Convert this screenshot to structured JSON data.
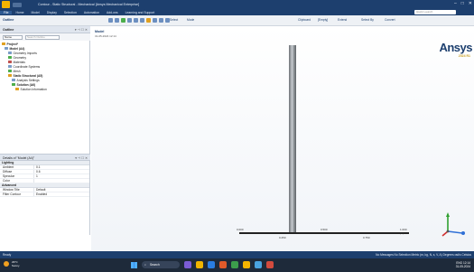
{
  "window": {
    "title": "Contour - Static Structural - Mechanical [Ansys Mechanical Enterprise]",
    "controls": [
      "–",
      "□",
      "✕"
    ]
  },
  "menubar": {
    "tabs": [
      "File",
      "Home",
      "Model",
      "Display",
      "Selection",
      "Automation",
      "Add-ons",
      "Learning and Support"
    ],
    "active_index": 0,
    "search_placeholder": "Quick Launch"
  },
  "toolbar": {
    "outline_label": "Outline",
    "select_label": "Select",
    "mode_label": "Mode",
    "clipboard_label": "Clipboard",
    "empty_label": "[Empty]",
    "extend_label": "Extend",
    "select_by_label": "Select By",
    "convert_label": "Convert"
  },
  "outline": {
    "header": "Outline",
    "pin": "▾ ⊣ ☐ ✕",
    "filter_label": "Name",
    "search_placeholder": "Search Outline",
    "tree": [
      {
        "label": "Project*",
        "level": 0,
        "icon": "project-icon",
        "bold": true
      },
      {
        "label": "Model (A4)",
        "level": 1,
        "icon": "model-icon",
        "bold": true
      },
      {
        "label": "Geometry Imports",
        "level": 2,
        "icon": "geometry-imports-icon"
      },
      {
        "label": "Geometry",
        "level": 2,
        "icon": "geometry-icon"
      },
      {
        "label": "Materials",
        "level": 2,
        "icon": "materials-icon"
      },
      {
        "label": "Coordinate Systems",
        "level": 2,
        "icon": "coordinate-systems-icon"
      },
      {
        "label": "Mesh",
        "level": 2,
        "icon": "mesh-icon"
      },
      {
        "label": "Static Structural (A5)",
        "level": 2,
        "icon": "static-structural-icon",
        "bold": true
      },
      {
        "label": "Analysis Settings",
        "level": 3,
        "icon": "analysis-settings-icon"
      },
      {
        "label": "Solution (A6)",
        "level": 3,
        "icon": "solution-icon",
        "bold": true
      },
      {
        "label": "Solution Information",
        "level": 4,
        "icon": "solution-information-icon"
      }
    ]
  },
  "details": {
    "header": "Details of \"Model (A4)\"",
    "pin": "▾ ⊣ ☐ ✕",
    "sections": [
      {
        "title": "Lighting",
        "rows": [
          {
            "key": "Ambient",
            "value": "0.1"
          },
          {
            "key": "Diffuse",
            "value": "0.6"
          },
          {
            "key": "Specular",
            "value": "1"
          },
          {
            "key": "Color",
            "value": ""
          }
        ]
      },
      {
        "title": "Advanced",
        "rows": [
          {
            "key": "Window Title",
            "value": "Default"
          },
          {
            "key": "Filter Contour",
            "value": "Enabled"
          }
        ]
      }
    ]
  },
  "viewport": {
    "title": "Model",
    "date": "31-05-2024 12:14",
    "brand": "Ansys",
    "version": "2024 R1",
    "scale": {
      "labels": [
        "0.000",
        "0.500",
        "1.000 (m)",
        "0.250",
        "0.750"
      ]
    }
  },
  "statusbar": {
    "left": "Ready",
    "right": "No Messages   No Selection   Metric (m, kg, N, s, V, A)   Degrees   rad/s   Celsius"
  },
  "taskbar": {
    "temperature": "29°C",
    "weather": "Sunny",
    "search_label": "Search",
    "tray_lang": "ENG",
    "tray_time": "12:14",
    "tray_date": "31-05-2024"
  },
  "colors": {
    "brand": "#1d3f6e",
    "accent": "#f5b400",
    "axis_x": "#d03030",
    "axis_y": "#30a030",
    "axis_z": "#2f6fd6"
  }
}
